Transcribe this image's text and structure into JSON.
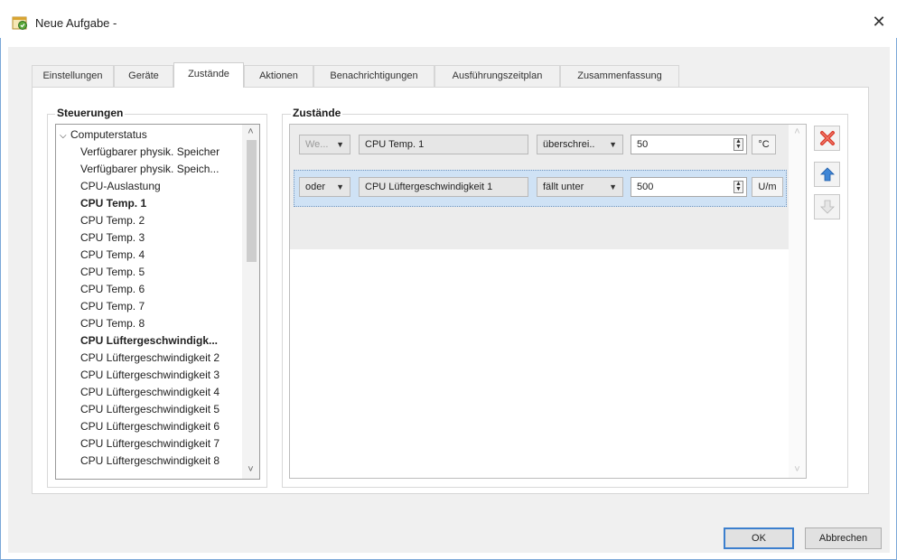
{
  "window": {
    "title": "Neue Aufgabe -",
    "close_glyph": "✕"
  },
  "tabs": [
    {
      "label": "Einstellungen"
    },
    {
      "label": "Geräte"
    },
    {
      "label": "Zustände"
    },
    {
      "label": "Aktionen"
    },
    {
      "label": "Benachrichtigungen"
    },
    {
      "label": "Ausführungszeitplan"
    },
    {
      "label": "Zusammenfassung"
    }
  ],
  "active_tab": "Zustände",
  "controls_panel": {
    "title": "Steuerungen",
    "root": "Computerstatus",
    "items": [
      "Verfügbarer physik. Speicher",
      "Verfügbarer physik. Speich...",
      "CPU-Auslastung",
      "CPU Temp. 1",
      "CPU Temp. 2",
      "CPU Temp. 3",
      "CPU Temp. 4",
      "CPU Temp. 5",
      "CPU Temp. 6",
      "CPU Temp. 7",
      "CPU Temp. 8",
      "CPU Lüftergeschwindigk...",
      "CPU Lüftergeschwindigkeit 2",
      "CPU Lüftergeschwindigkeit 3",
      "CPU Lüftergeschwindigkeit 4",
      "CPU Lüftergeschwindigkeit 5",
      "CPU Lüftergeschwindigkeit 6",
      "CPU Lüftergeschwindigkeit 7",
      "CPU Lüftergeschwindigkeit 8"
    ],
    "bold_items": [
      "CPU Temp. 1",
      "CPU Lüftergeschwindigk..."
    ]
  },
  "states_panel": {
    "title": "Zustände",
    "rows": [
      {
        "logic": "We...",
        "sensor": "CPU Temp. 1",
        "operator": "überschrei..",
        "value": "50",
        "unit": "°C"
      },
      {
        "logic": "oder",
        "sensor": "CPU Lüftergeschwindigkeit 1",
        "operator": "fällt unter",
        "value": "500",
        "unit": "U/m"
      }
    ]
  },
  "side_buttons": {
    "delete_icon": "delete-x-icon",
    "move_up_icon": "arrow-up-icon",
    "move_down_icon": "arrow-down-icon"
  },
  "buttons": {
    "ok": "OK",
    "cancel": "Abbrechen"
  },
  "colors": {
    "selection": "#cfe2f5",
    "accent": "#3c7fce",
    "delete_red": "#d93a2b",
    "arrow_blue": "#3f86d6"
  }
}
